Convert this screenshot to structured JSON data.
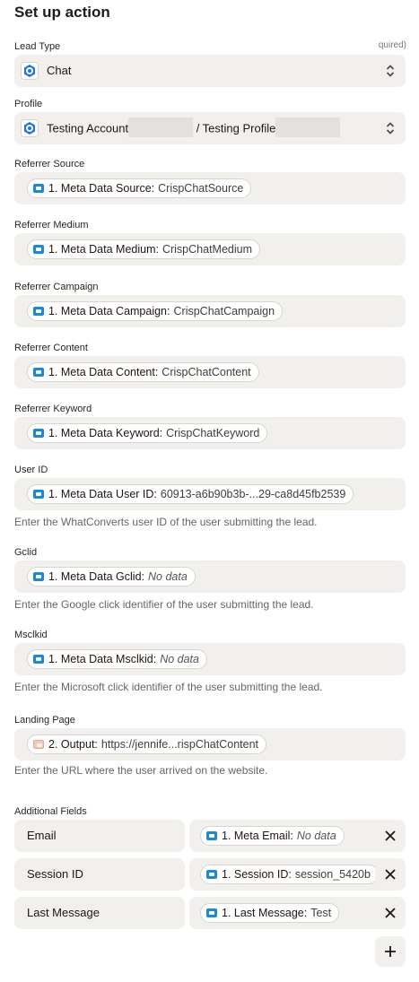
{
  "header": {
    "title": "Set up action"
  },
  "required_hint": "quired)",
  "lead_type": {
    "label": "Lead Type",
    "value": "Chat"
  },
  "profile": {
    "label": "Profile",
    "account": "Testing Account",
    "separator": "/ Testing Profile"
  },
  "fields": [
    {
      "label": "Referrer Source",
      "key": "1. Meta Data Source:",
      "value": "CrispChatSource"
    },
    {
      "label": "Referrer Medium",
      "key": "1. Meta Data Medium:",
      "value": "CrispChatMedium"
    },
    {
      "label": "Referrer Campaign",
      "key": "1. Meta Data Campaign:",
      "value": "CrispChatCampaign"
    },
    {
      "label": "Referrer Content",
      "key": "1. Meta Data Content:",
      "value": "CrispChatContent"
    },
    {
      "label": "Referrer Keyword",
      "key": "1. Meta Data Keyword:",
      "value": "CrispChatKeyword"
    },
    {
      "label": "User ID",
      "key": "1. Meta Data User ID:",
      "value": "60913-a6b90b3b-...29-ca8d45fb2539",
      "help": "Enter the WhatConverts user ID of the user submitting the lead."
    },
    {
      "label": "Gclid",
      "key": "1. Meta Data Gclid:",
      "value": "No data",
      "help": "Enter the Google click identifier of the user submitting the lead."
    },
    {
      "label": "Msclkid",
      "key": "1. Meta Data Msclkid:",
      "value": "No data",
      "help": "Enter the Microsoft click identifier of the user submitting the lead."
    },
    {
      "label": "Landing Page",
      "key": "2. Output:",
      "value": "https://jennife...rispChatContent",
      "help": "Enter the URL where the user arrived on the website."
    }
  ],
  "additional": {
    "label": "Additional Fields",
    "rows": [
      {
        "name": "Email",
        "key": "1. Meta Email:",
        "value": "No data"
      },
      {
        "name": "Session ID",
        "key": "1. Session ID:",
        "value": "session_5420b"
      },
      {
        "name": "Last Message",
        "key": "1. Last Message:",
        "value": "Test"
      }
    ]
  },
  "icons": {
    "app": "crisp-app-icon",
    "step": "chat-step-icon",
    "formatter": "formatter-step-icon",
    "remove": "close-icon",
    "add": "plus-icon",
    "select": "up-down-chevron-icon"
  },
  "colors": {
    "field_bg": "#f2f0ed",
    "step_icon": "#1a8ad6",
    "app_icon": "#1972f5"
  }
}
